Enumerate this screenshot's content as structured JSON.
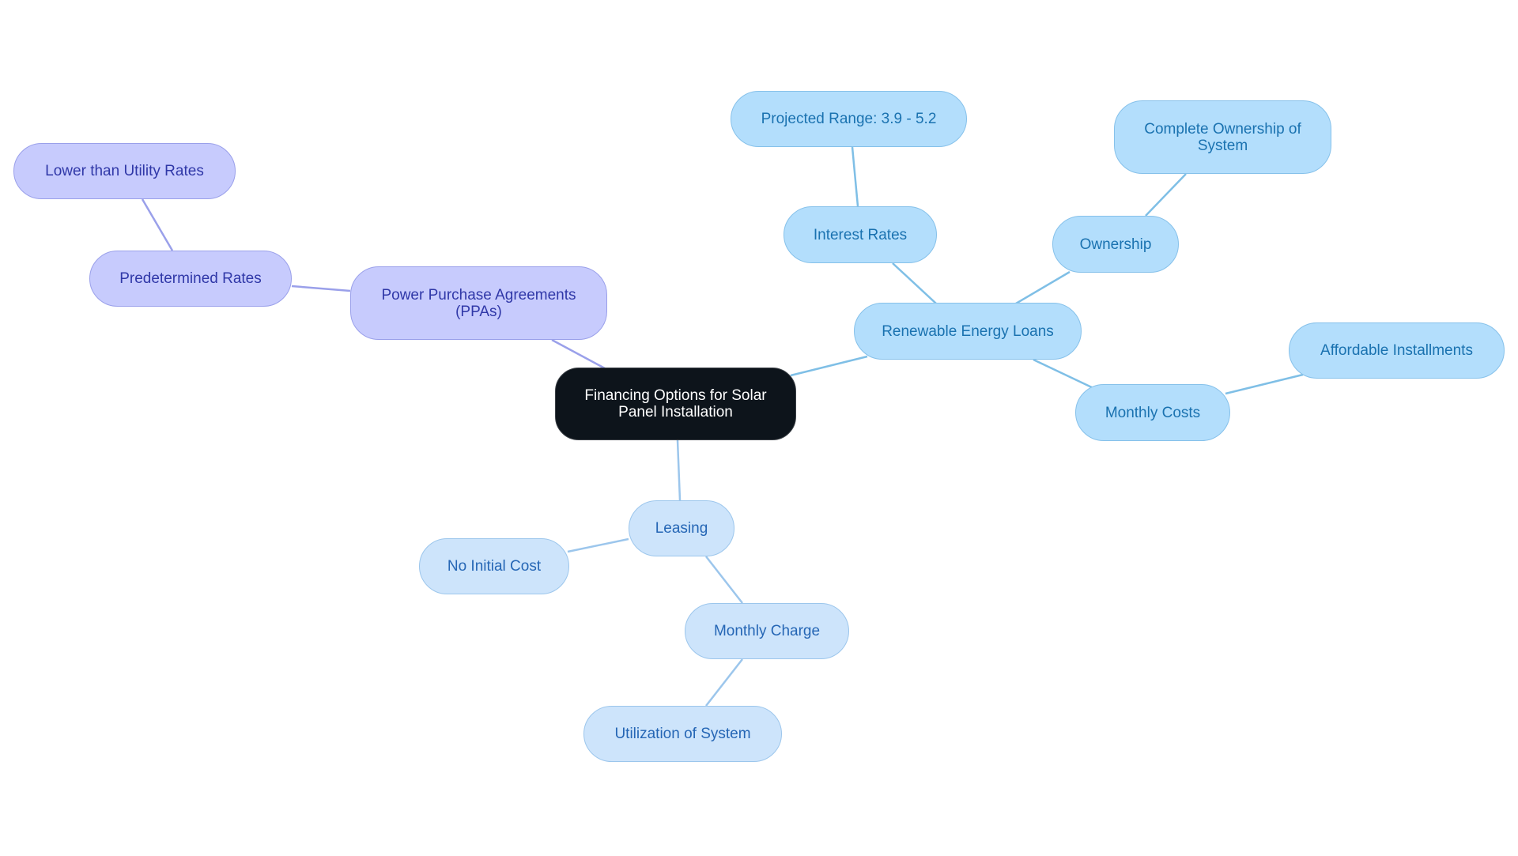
{
  "diagram": {
    "type": "mind-map",
    "colors": {
      "root_fill": "#0d141b",
      "root_text": "#ffffff",
      "ppa_fill": "#c7cbfd",
      "ppa_text": "#3038a8",
      "ppa_edge": "#9aa0ea",
      "loan_fill": "#b3defc",
      "loan_text": "#1a72b0",
      "loan_edge": "#7fbfe6",
      "lease_fill": "#cde4fb",
      "lease_text": "#2566b5",
      "lease_edge": "#9cc6ec"
    },
    "nodes": {
      "root": "Financing Options for Solar Panel Installation",
      "ppa": "Power Purchase Agreements (PPAs)",
      "predetermined": "Predetermined Rates",
      "lower_than_utility": "Lower than Utility Rates",
      "loans": "Renewable Energy Loans",
      "interest": "Interest Rates",
      "projected": "Projected Range: 3.9 - 5.2",
      "ownership": "Ownership",
      "complete_ownership": "Complete Ownership of System",
      "monthly_costs": "Monthly Costs",
      "affordable": "Affordable Installments",
      "leasing": "Leasing",
      "no_initial": "No Initial Cost",
      "monthly_charge": "Monthly Charge",
      "utilization": "Utilization of System"
    },
    "edges": [
      [
        "root",
        "ppa"
      ],
      [
        "ppa",
        "predetermined"
      ],
      [
        "predetermined",
        "lower_than_utility"
      ],
      [
        "root",
        "loans"
      ],
      [
        "loans",
        "interest"
      ],
      [
        "interest",
        "projected"
      ],
      [
        "loans",
        "ownership"
      ],
      [
        "ownership",
        "complete_ownership"
      ],
      [
        "loans",
        "monthly_costs"
      ],
      [
        "monthly_costs",
        "affordable"
      ],
      [
        "root",
        "leasing"
      ],
      [
        "leasing",
        "no_initial"
      ],
      [
        "leasing",
        "monthly_charge"
      ],
      [
        "monthly_charge",
        "utilization"
      ]
    ]
  }
}
